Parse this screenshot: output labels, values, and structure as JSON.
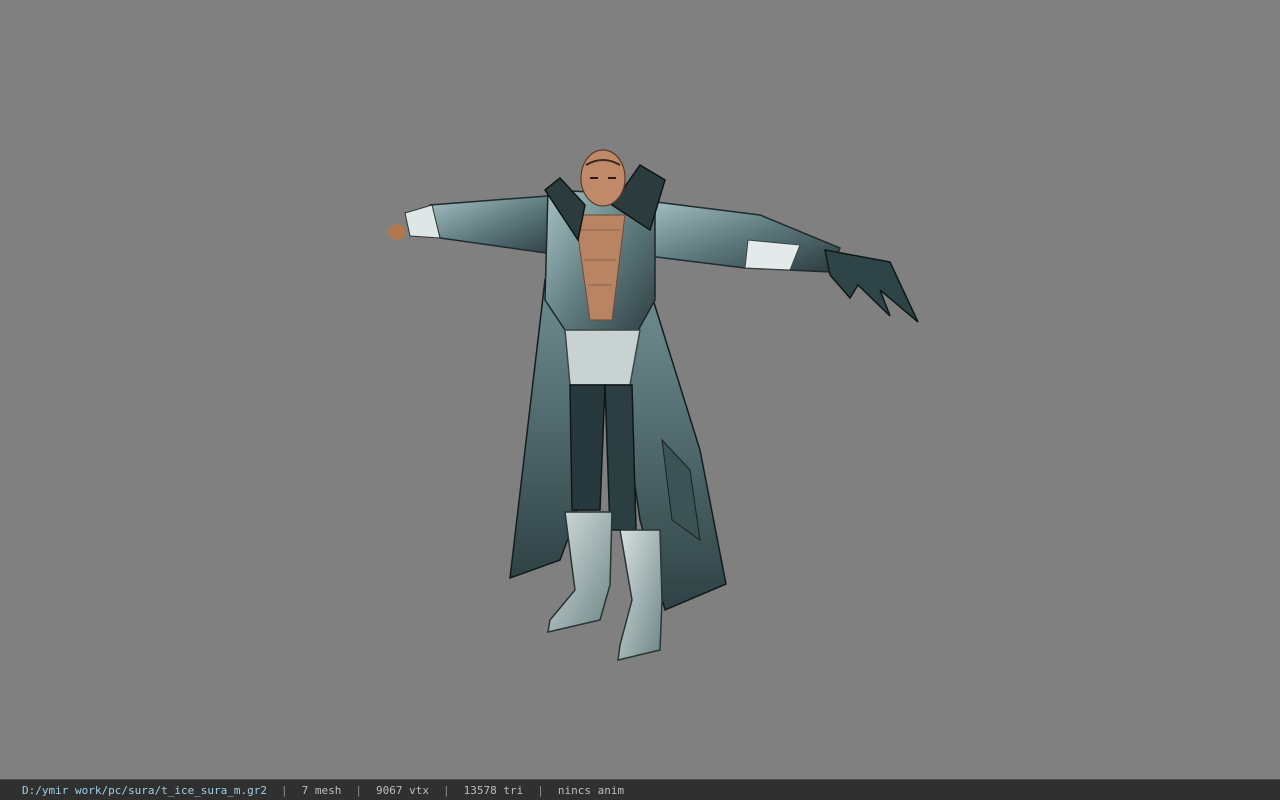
{
  "viewer": {
    "background_color": "#808080",
    "model_subject": "sura character in ice armor, T-pose"
  },
  "status_bar": {
    "file_path": "D:/ymir work/pc/sura/t_ice_sura_m.gr2",
    "separator": "|",
    "mesh_count": "7 mesh",
    "vertex_count": "9067 vtx",
    "triangle_count": "13578 tri",
    "animation": "nincs anim"
  }
}
